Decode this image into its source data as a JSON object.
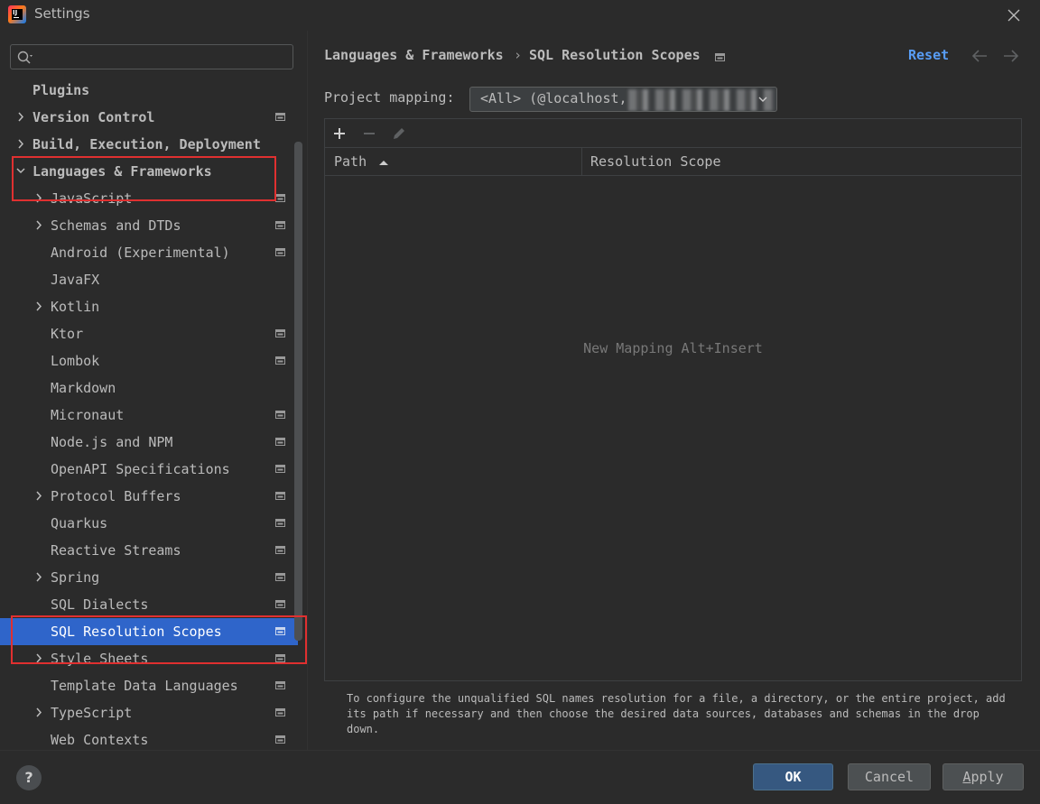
{
  "window": {
    "title": "Settings",
    "app_icon_letters": "IJ"
  },
  "sidebar": {
    "search": {
      "value": "",
      "placeholder": ""
    },
    "items": [
      {
        "label": "Plugins",
        "level": 0,
        "bold": true,
        "expander": "none",
        "project_icon": false,
        "selected": false
      },
      {
        "label": "Version Control",
        "level": 0,
        "bold": true,
        "expander": "collapsed",
        "project_icon": true,
        "selected": false
      },
      {
        "label": "Build, Execution, Deployment",
        "level": 0,
        "bold": true,
        "expander": "collapsed",
        "project_icon": false,
        "selected": false
      },
      {
        "label": "Languages & Frameworks",
        "level": 0,
        "bold": true,
        "expander": "expanded",
        "project_icon": false,
        "selected": false
      },
      {
        "label": "JavaScript",
        "level": 1,
        "bold": false,
        "expander": "collapsed",
        "project_icon": true,
        "selected": false
      },
      {
        "label": "Schemas and DTDs",
        "level": 1,
        "bold": false,
        "expander": "collapsed",
        "project_icon": true,
        "selected": false
      },
      {
        "label": "Android (Experimental)",
        "level": 1,
        "bold": false,
        "expander": "none",
        "project_icon": true,
        "selected": false
      },
      {
        "label": "JavaFX",
        "level": 1,
        "bold": false,
        "expander": "none",
        "project_icon": false,
        "selected": false
      },
      {
        "label": "Kotlin",
        "level": 1,
        "bold": false,
        "expander": "collapsed",
        "project_icon": false,
        "selected": false
      },
      {
        "label": "Ktor",
        "level": 1,
        "bold": false,
        "expander": "none",
        "project_icon": true,
        "selected": false
      },
      {
        "label": "Lombok",
        "level": 1,
        "bold": false,
        "expander": "none",
        "project_icon": true,
        "selected": false
      },
      {
        "label": "Markdown",
        "level": 1,
        "bold": false,
        "expander": "none",
        "project_icon": false,
        "selected": false
      },
      {
        "label": "Micronaut",
        "level": 1,
        "bold": false,
        "expander": "none",
        "project_icon": true,
        "selected": false
      },
      {
        "label": "Node.js and NPM",
        "level": 1,
        "bold": false,
        "expander": "none",
        "project_icon": true,
        "selected": false
      },
      {
        "label": "OpenAPI Specifications",
        "level": 1,
        "bold": false,
        "expander": "none",
        "project_icon": true,
        "selected": false
      },
      {
        "label": "Protocol Buffers",
        "level": 1,
        "bold": false,
        "expander": "collapsed",
        "project_icon": true,
        "selected": false
      },
      {
        "label": "Quarkus",
        "level": 1,
        "bold": false,
        "expander": "none",
        "project_icon": true,
        "selected": false
      },
      {
        "label": "Reactive Streams",
        "level": 1,
        "bold": false,
        "expander": "none",
        "project_icon": true,
        "selected": false
      },
      {
        "label": "Spring",
        "level": 1,
        "bold": false,
        "expander": "collapsed",
        "project_icon": true,
        "selected": false
      },
      {
        "label": "SQL Dialects",
        "level": 1,
        "bold": false,
        "expander": "none",
        "project_icon": true,
        "selected": false
      },
      {
        "label": "SQL Resolution Scopes",
        "level": 1,
        "bold": false,
        "expander": "none",
        "project_icon": true,
        "selected": true
      },
      {
        "label": "Style Sheets",
        "level": 1,
        "bold": false,
        "expander": "collapsed",
        "project_icon": true,
        "selected": false
      },
      {
        "label": "Template Data Languages",
        "level": 1,
        "bold": false,
        "expander": "none",
        "project_icon": true,
        "selected": false
      },
      {
        "label": "TypeScript",
        "level": 1,
        "bold": false,
        "expander": "collapsed",
        "project_icon": true,
        "selected": false
      },
      {
        "label": "Web Contexts",
        "level": 1,
        "bold": false,
        "expander": "none",
        "project_icon": true,
        "selected": false
      }
    ]
  },
  "header": {
    "breadcrumb": [
      "Languages & Frameworks",
      "SQL Resolution Scopes"
    ],
    "breadcrumb_separator": "›",
    "reset_label": "Reset"
  },
  "mapping": {
    "label": "Project mapping:",
    "selected_value": "<All> (@localhost,"
  },
  "table": {
    "columns": [
      "Path",
      "Resolution Scope"
    ],
    "rows": [],
    "empty_text": "New Mapping Alt+Insert"
  },
  "hint": "To configure the unqualified SQL names resolution for a file, a directory, or the entire project, add its path if necessary and then choose the desired data sources, databases and schemas in the drop down.",
  "footer": {
    "help_label": "?",
    "ok_label": "OK",
    "cancel_label": "Cancel",
    "apply_label": "Apply"
  },
  "colors": {
    "background": "#2b2b2b",
    "selection": "#2f65ca",
    "link": "#589df6",
    "primary_button": "#365880",
    "annotation_box": "#e03030"
  }
}
